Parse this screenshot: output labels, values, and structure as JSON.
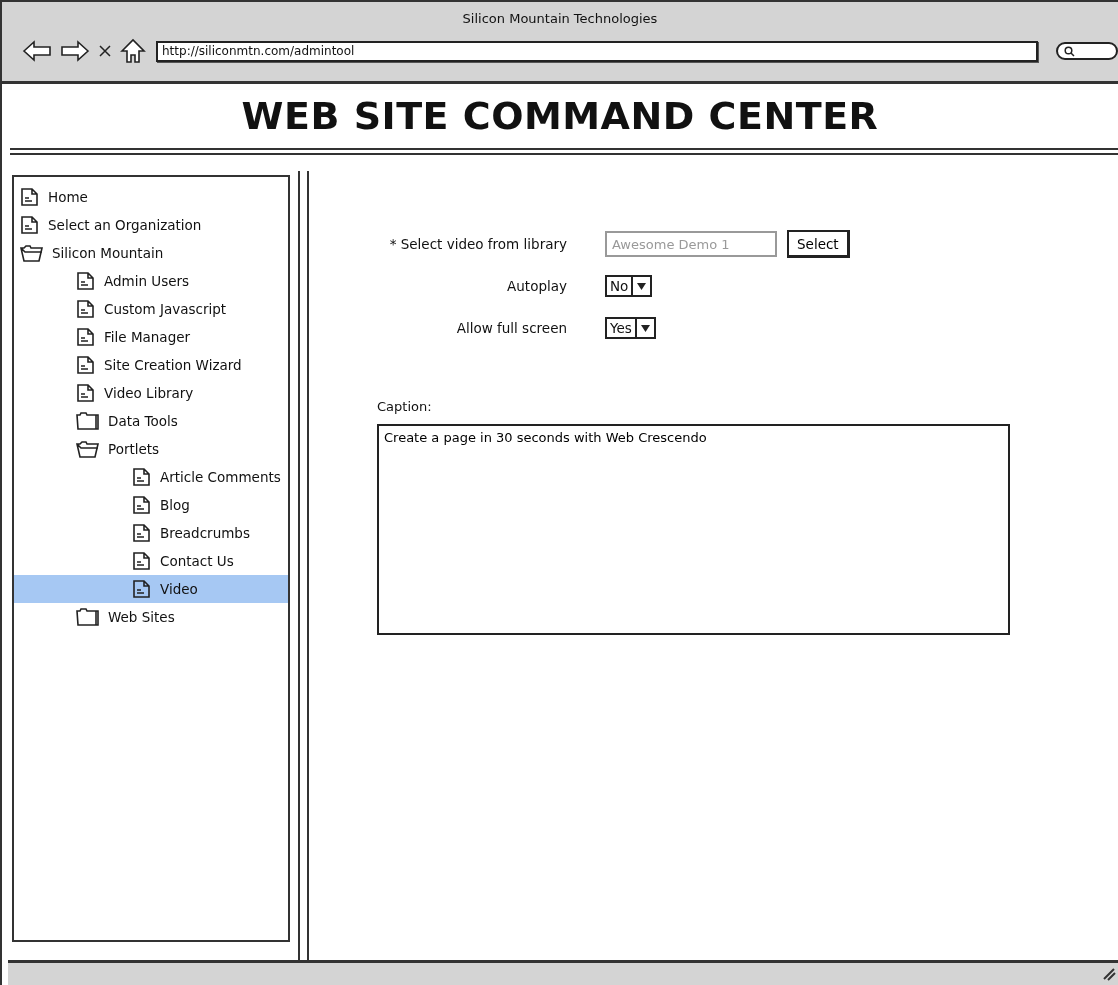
{
  "window": {
    "title": "Silicon Mountain Technologies"
  },
  "address_bar": {
    "url": "http://siliconmtn.com/admintool"
  },
  "header": {
    "title": "WEB SITE COMMAND CENTER"
  },
  "sidebar": {
    "items": [
      {
        "label": "Home",
        "kind": "page",
        "selected": false
      },
      {
        "label": "Select an Organization",
        "kind": "page",
        "selected": false
      },
      {
        "label": "Silicon Mountain",
        "kind": "folder",
        "expanded": true,
        "selected": false,
        "children": [
          {
            "label": "Admin Users",
            "kind": "page",
            "selected": false
          },
          {
            "label": "Custom Javascript",
            "kind": "page",
            "selected": false
          },
          {
            "label": "File Manager",
            "kind": "page",
            "selected": false
          },
          {
            "label": "Site Creation Wizard",
            "kind": "page",
            "selected": false
          },
          {
            "label": "Video Library",
            "kind": "page",
            "selected": false
          },
          {
            "label": "Data Tools",
            "kind": "folder",
            "expanded": false,
            "selected": false
          },
          {
            "label": "Portlets",
            "kind": "folder",
            "expanded": true,
            "selected": false,
            "children": [
              {
                "label": "Article Comments",
                "kind": "page",
                "selected": false
              },
              {
                "label": "Blog",
                "kind": "page",
                "selected": false
              },
              {
                "label": "Breadcrumbs",
                "kind": "page",
                "selected": false
              },
              {
                "label": "Contact Us",
                "kind": "page",
                "selected": false
              },
              {
                "label": "Video",
                "kind": "page",
                "selected": true
              }
            ]
          },
          {
            "label": "Web Sites",
            "kind": "folder",
            "expanded": false,
            "selected": false
          }
        ]
      }
    ]
  },
  "form": {
    "fields": [
      {
        "kind": "picker",
        "label": "* Select video from library",
        "placeholder": "Awesome Demo 1",
        "button": "Select"
      },
      {
        "kind": "dropdown",
        "label": "Autoplay",
        "value": "No"
      },
      {
        "kind": "dropdown",
        "label": "Allow full screen",
        "value": "Yes"
      }
    ],
    "caption": {
      "label": "Caption:",
      "value": "Create a page in 30 seconds with Web Crescendo"
    }
  }
}
